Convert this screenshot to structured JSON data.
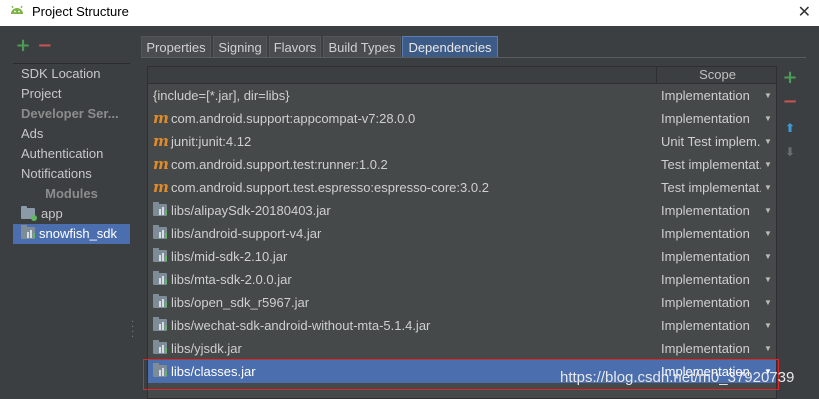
{
  "window": {
    "title": "Project Structure",
    "close_glyph": "✕",
    "icon": "android-icon"
  },
  "left_toolbar": {
    "add": "+",
    "remove": "−"
  },
  "left_nav": [
    {
      "label": "SDK Location",
      "kind": "item"
    },
    {
      "label": "Project",
      "kind": "item"
    },
    {
      "label": "Developer Ser...",
      "kind": "header"
    },
    {
      "label": "Ads",
      "kind": "item"
    },
    {
      "label": "Authentication",
      "kind": "item"
    },
    {
      "label": "Notifications",
      "kind": "item"
    },
    {
      "label": "Modules",
      "kind": "header"
    },
    {
      "label": "app",
      "kind": "module"
    },
    {
      "label": "snowfish_sdk",
      "kind": "module",
      "selected": true
    }
  ],
  "tabs": [
    {
      "label": "Properties"
    },
    {
      "label": "Signing"
    },
    {
      "label": "Flavors"
    },
    {
      "label": "Build Types"
    },
    {
      "label": "Dependencies",
      "active": true
    }
  ],
  "table": {
    "scope_header": "Scope",
    "rows": [
      {
        "name": "{include=[*.jar], dir=libs}",
        "scope": "Implementation",
        "icon": "none"
      },
      {
        "name": "com.android.support:appcompat-v7:28.0.0",
        "scope": "Implementation",
        "icon": "maven-icon"
      },
      {
        "name": "junit:junit:4.12",
        "scope": "Unit Test implem...",
        "icon": "maven-icon"
      },
      {
        "name": "com.android.support.test:runner:1.0.2",
        "scope": "Test implementat...",
        "icon": "maven-icon"
      },
      {
        "name": "com.android.support.test.espresso:espresso-core:3.0.2",
        "scope": "Test implementat...",
        "icon": "maven-icon"
      },
      {
        "name": "libs/alipaySdk-20180403.jar",
        "scope": "Implementation",
        "icon": "jar-icon"
      },
      {
        "name": "libs/android-support-v4.jar",
        "scope": "Implementation",
        "icon": "jar-icon"
      },
      {
        "name": "libs/mid-sdk-2.10.jar",
        "scope": "Implementation",
        "icon": "jar-icon"
      },
      {
        "name": "libs/mta-sdk-2.0.0.jar",
        "scope": "Implementation",
        "icon": "jar-icon"
      },
      {
        "name": "libs/open_sdk_r5967.jar",
        "scope": "Implementation",
        "icon": "jar-icon"
      },
      {
        "name": "libs/wechat-sdk-android-without-mta-5.1.4.jar",
        "scope": "Implementation",
        "icon": "jar-icon"
      },
      {
        "name": "libs/yjsdk.jar",
        "scope": "Implementation",
        "icon": "jar-icon"
      },
      {
        "name": "libs/classes.jar",
        "scope": "Implementation",
        "icon": "jar-icon",
        "selected": true
      }
    ]
  },
  "right_toolbar": {
    "add": "+",
    "remove": "−",
    "move_up": "⬆",
    "move_down": "⬇"
  },
  "watermark": "https://blog.csdn.net/m0_37920739",
  "colors": {
    "background": "#3c3f41",
    "selection": "#4b6eaf",
    "maven": "#e08a29",
    "add": "#499c54",
    "remove": "#c75450",
    "highlight": "#e0262a"
  }
}
